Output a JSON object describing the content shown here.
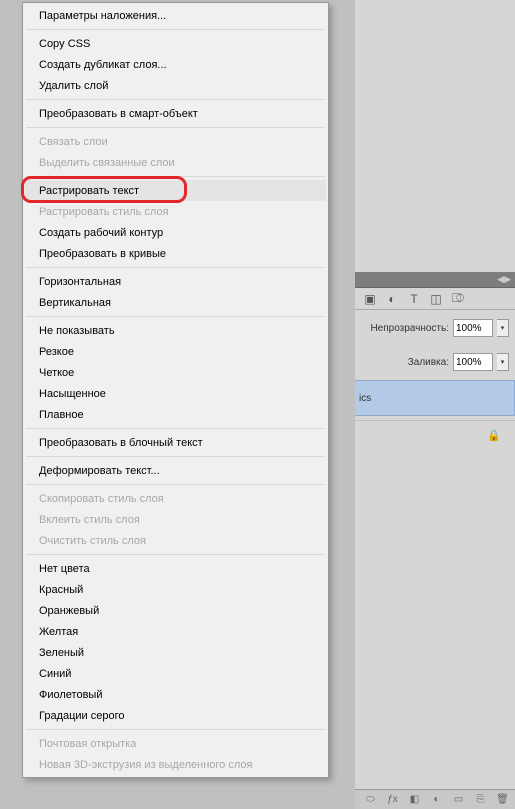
{
  "menu": {
    "items": [
      {
        "label": "Параметры наложения...",
        "type": "item"
      },
      {
        "type": "sep"
      },
      {
        "label": "Copy CSS",
        "type": "item"
      },
      {
        "label": "Создать дубликат слоя...",
        "type": "item"
      },
      {
        "label": "Удалить слой",
        "type": "item"
      },
      {
        "type": "sep"
      },
      {
        "label": "Преобразовать в смарт-объект",
        "type": "item"
      },
      {
        "type": "sep"
      },
      {
        "label": "Связать слои",
        "type": "item",
        "disabled": true
      },
      {
        "label": "Выделить связанные слои",
        "type": "item",
        "disabled": true
      },
      {
        "type": "sep"
      },
      {
        "label": "Растрировать текст",
        "type": "item",
        "hover": true,
        "highlight": true
      },
      {
        "label": "Растрировать стиль слоя",
        "type": "item",
        "disabled": true
      },
      {
        "label": "Создать рабочий контур",
        "type": "item"
      },
      {
        "label": "Преобразовать в кривые",
        "type": "item"
      },
      {
        "type": "sep"
      },
      {
        "label": "Горизонтальная",
        "type": "item"
      },
      {
        "label": "Вертикальная",
        "type": "item"
      },
      {
        "type": "sep"
      },
      {
        "label": "Не показывать",
        "type": "item"
      },
      {
        "label": "Резкое",
        "type": "item"
      },
      {
        "label": "Четкое",
        "type": "item"
      },
      {
        "label": "Насыщенное",
        "type": "item"
      },
      {
        "label": "Плавное",
        "type": "item"
      },
      {
        "type": "sep"
      },
      {
        "label": "Преобразовать в блочный текст",
        "type": "item"
      },
      {
        "type": "sep"
      },
      {
        "label": "Деформировать текст...",
        "type": "item"
      },
      {
        "type": "sep"
      },
      {
        "label": "Скопировать стиль слоя",
        "type": "item",
        "disabled": true
      },
      {
        "label": "Вклеить стиль слоя",
        "type": "item",
        "disabled": true
      },
      {
        "label": "Очистить стиль слоя",
        "type": "item",
        "disabled": true
      },
      {
        "type": "sep"
      },
      {
        "label": "Нет цвета",
        "type": "item"
      },
      {
        "label": "Красный",
        "type": "item"
      },
      {
        "label": "Оранжевый",
        "type": "item"
      },
      {
        "label": "Желтая",
        "type": "item"
      },
      {
        "label": "Зеленый",
        "type": "item"
      },
      {
        "label": "Синий",
        "type": "item"
      },
      {
        "label": "Фиолетовый",
        "type": "item"
      },
      {
        "label": "Градации серого",
        "type": "item"
      },
      {
        "type": "sep"
      },
      {
        "label": "Почтовая открытка",
        "type": "item",
        "disabled": true
      },
      {
        "label": "Новая 3D-экструзия из выделенного слоя",
        "type": "item",
        "disabled": true
      }
    ]
  },
  "panel": {
    "opacity_label": "Непрозрачность:",
    "opacity_value": "100%",
    "fill_label": "Заливка:",
    "fill_value": "100%",
    "layer_name": "ics"
  }
}
